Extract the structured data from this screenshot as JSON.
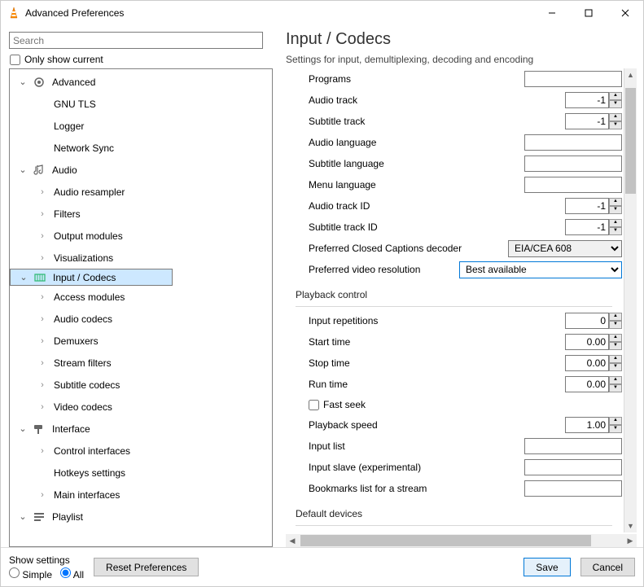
{
  "window": {
    "title": "Advanced Preferences"
  },
  "search": {
    "placeholder": "Search"
  },
  "only_show_current": "Only show current",
  "tree": {
    "advanced": {
      "label": "Advanced",
      "children": [
        "GNU TLS",
        "Logger",
        "Network Sync"
      ]
    },
    "audio": {
      "label": "Audio",
      "children": [
        "Audio resampler",
        "Filters",
        "Output modules",
        "Visualizations"
      ]
    },
    "input_codecs": {
      "label": "Input / Codecs",
      "children": [
        "Access modules",
        "Audio codecs",
        "Demuxers",
        "Stream filters",
        "Subtitle codecs",
        "Video codecs"
      ]
    },
    "interface": {
      "label": "Interface",
      "children": [
        "Control interfaces",
        "Hotkeys settings",
        "Main interfaces"
      ]
    },
    "playlist": {
      "label": "Playlist"
    }
  },
  "page": {
    "title": "Input / Codecs",
    "subtitle": "Settings for input, demultiplexing, decoding and encoding",
    "fields": {
      "programs": {
        "label": "Programs",
        "value": ""
      },
      "audio_track": {
        "label": "Audio track",
        "value": "-1"
      },
      "subtitle_track": {
        "label": "Subtitle track",
        "value": "-1"
      },
      "audio_language": {
        "label": "Audio language",
        "value": ""
      },
      "subtitle_language": {
        "label": "Subtitle language",
        "value": ""
      },
      "menu_language": {
        "label": "Menu language",
        "value": ""
      },
      "audio_track_id": {
        "label": "Audio track ID",
        "value": "-1"
      },
      "subtitle_track_id": {
        "label": "Subtitle track ID",
        "value": "-1"
      },
      "cc_decoder": {
        "label": "Preferred Closed Captions decoder",
        "value": "EIA/CEA 608"
      },
      "video_resolution": {
        "label": "Preferred video resolution",
        "value": "Best available"
      }
    },
    "playback": {
      "title": "Playback control",
      "input_repetitions": {
        "label": "Input repetitions",
        "value": "0"
      },
      "start_time": {
        "label": "Start time",
        "value": "0.00"
      },
      "stop_time": {
        "label": "Stop time",
        "value": "0.00"
      },
      "run_time": {
        "label": "Run time",
        "value": "0.00"
      },
      "fast_seek": "Fast seek",
      "playback_speed": {
        "label": "Playback speed",
        "value": "1.00"
      },
      "input_list": {
        "label": "Input list",
        "value": ""
      },
      "input_slave": {
        "label": "Input slave (experimental)",
        "value": ""
      },
      "bookmarks": {
        "label": "Bookmarks list for a stream",
        "value": ""
      }
    },
    "default_devices": {
      "title": "Default devices"
    }
  },
  "footer": {
    "show_settings": "Show settings",
    "simple": "Simple",
    "all": "All",
    "reset": "Reset Preferences",
    "save": "Save",
    "cancel": "Cancel"
  }
}
